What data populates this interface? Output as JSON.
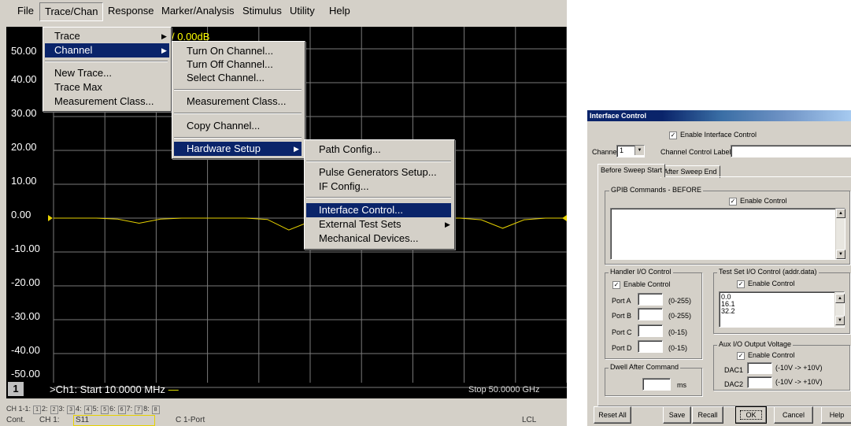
{
  "menubar": [
    "File",
    "Trace/Chan",
    "Response",
    "Marker/Analysis",
    "Stimulus",
    "Utility",
    "Help"
  ],
  "menu_trace_chan": {
    "items": [
      "Trace",
      "Channel",
      "New Trace...",
      "Trace Max",
      "Measurement Class..."
    ]
  },
  "menu_channel": {
    "items": [
      "Turn On Channel...",
      "Turn Off Channel...",
      "Select Channel...",
      "Measurement Class...",
      "Copy Channel...",
      "Hardware Setup"
    ]
  },
  "menu_hardware": {
    "items": [
      "Path Config...",
      "Pulse Generators Setup...",
      "IF Config...",
      "Interface Control...",
      "External Test Sets",
      "Mechanical Devices..."
    ]
  },
  "plot": {
    "y_tick_labels": [
      "50.00",
      "40.00",
      "30.00",
      "20.00",
      "10.00",
      "0.00",
      "-10.00",
      "-20.00",
      "-30.00",
      "-40.00",
      "-50.00"
    ],
    "marker_label": "/ 0.00dB",
    "channel_number": "1",
    "start_label": ">Ch1: Start  10.0000 MHz",
    "start_dash": "—",
    "stop_label": "Stop  50.0000 GHz"
  },
  "chart_data": {
    "type": "line",
    "xlabel": "",
    "ylabel": "",
    "ylim": [
      -50,
      50
    ],
    "xlim_label": [
      "10.0000 MHz",
      "50.0000 GHz"
    ],
    "series": [
      {
        "values": [
          0,
          0,
          0,
          -0.3,
          -1.5,
          -0.3,
          0,
          0,
          0,
          0,
          -0.4,
          -3.5,
          -1,
          0,
          0,
          0,
          0,
          0,
          0,
          0,
          -0.5,
          -3,
          -0.5,
          0,
          0
        ]
      }
    ],
    "trace_color": "#e6d100",
    "grid": true
  },
  "status": {
    "channels_label": "CH 1-1:",
    "channel_boxes": [
      "1",
      "2",
      "3",
      "4",
      "5",
      "6",
      "7",
      "8"
    ],
    "channel_box_labels": [
      "2:",
      "3:",
      "4:",
      "5:",
      "6:",
      "7:",
      "8:"
    ],
    "row2_cont": "Cont.",
    "row2_ch": "CH 1:",
    "row2_s11": "S11",
    "row2_port": "C  1-Port",
    "row2_lcl": "LCL"
  },
  "dialog": {
    "title": "Interface Control",
    "enable_interface_control": "Enable Interface Control",
    "channel_label": "Channel",
    "channel_value": "1",
    "channel_control_label": "Channel Control Label:",
    "tabs": [
      "Before Sweep Start",
      "After Sweep End"
    ],
    "gpib_group": "GPIB Commands - BEFORE",
    "enable_control": "Enable Control",
    "handler_group": "Handler I/O Control",
    "ports": [
      {
        "label": "Port A",
        "range": "(0-255)"
      },
      {
        "label": "Port B",
        "range": "(0-255)"
      },
      {
        "label": "Port C",
        "range": "(0-15)"
      },
      {
        "label": "Port D",
        "range": "(0-15)"
      }
    ],
    "testset_group": "Test Set I/O Control (addr.data)",
    "testset_values": [
      "0.0",
      "16.1",
      "32.2"
    ],
    "aux_group": "Aux I/O Output Voltage",
    "dac1_label": "DAC1",
    "dac2_label": "DAC2",
    "dac_range": "(-10V -> +10V)",
    "dwell_group": "Dwell After Command",
    "dwell_unit": "ms",
    "buttons": [
      "Reset All",
      "Save",
      "Recall",
      "OK",
      "Cancel",
      "Help"
    ]
  },
  "icons": {
    "checkmark": "check-icon",
    "dropdown": "chevron-down-icon",
    "submenu": "chevron-right-icon"
  }
}
